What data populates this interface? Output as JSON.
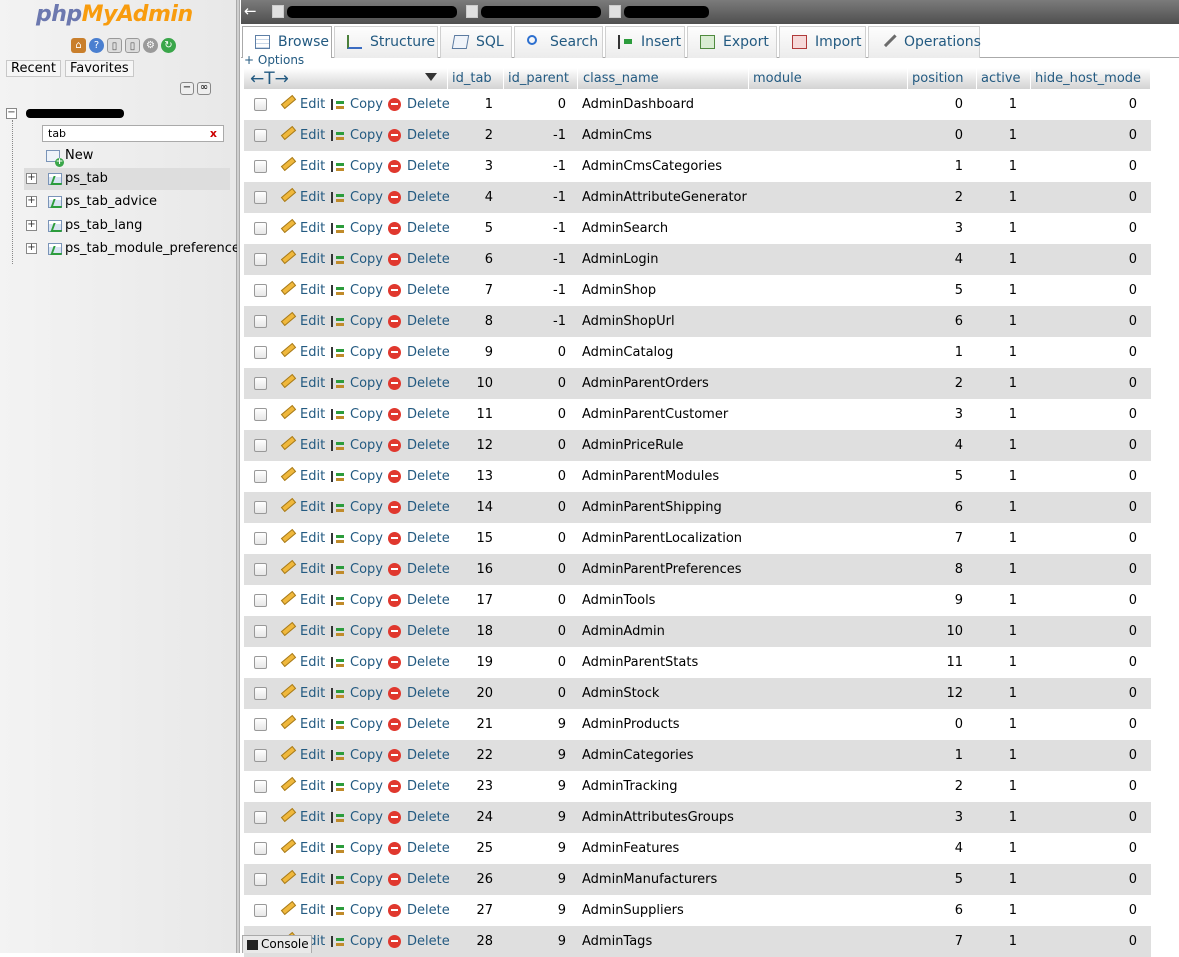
{
  "logo": {
    "php": "php",
    "myadmin": "MyAdmin"
  },
  "nav": {
    "tabs": [
      "Recent",
      "Favorites"
    ],
    "filter_value": "tab",
    "filter_clear": "x",
    "new_label": "New",
    "tables": [
      "ps_tab",
      "ps_tab_advice",
      "ps_tab_lang",
      "ps_tab_module_preference"
    ],
    "selected_table": "ps_tab"
  },
  "tabs": [
    {
      "label": "Browse",
      "icon": "browse-icon",
      "active": true
    },
    {
      "label": "Structure",
      "icon": "structure-icon"
    },
    {
      "label": "SQL",
      "icon": "sql-icon"
    },
    {
      "label": "Search",
      "icon": "search-icon"
    },
    {
      "label": "Insert",
      "icon": "insert-icon"
    },
    {
      "label": "Export",
      "icon": "export-icon"
    },
    {
      "label": "Import",
      "icon": "import-icon"
    },
    {
      "label": "Operations",
      "icon": "operations-icon"
    }
  ],
  "options_label": "+ Options",
  "column_arrows": "←T→",
  "columns": [
    "id_tab",
    "id_parent",
    "class_name",
    "module",
    "position",
    "active",
    "hide_host_mode"
  ],
  "actions": {
    "edit": "Edit",
    "copy": "Copy",
    "delete": "Delete"
  },
  "rows": [
    [
      "1",
      "0",
      "AdminDashboard",
      "",
      "0",
      "1",
      "0"
    ],
    [
      "2",
      "-1",
      "AdminCms",
      "",
      "0",
      "1",
      "0"
    ],
    [
      "3",
      "-1",
      "AdminCmsCategories",
      "",
      "1",
      "1",
      "0"
    ],
    [
      "4",
      "-1",
      "AdminAttributeGenerator",
      "",
      "2",
      "1",
      "0"
    ],
    [
      "5",
      "-1",
      "AdminSearch",
      "",
      "3",
      "1",
      "0"
    ],
    [
      "6",
      "-1",
      "AdminLogin",
      "",
      "4",
      "1",
      "0"
    ],
    [
      "7",
      "-1",
      "AdminShop",
      "",
      "5",
      "1",
      "0"
    ],
    [
      "8",
      "-1",
      "AdminShopUrl",
      "",
      "6",
      "1",
      "0"
    ],
    [
      "9",
      "0",
      "AdminCatalog",
      "",
      "1",
      "1",
      "0"
    ],
    [
      "10",
      "0",
      "AdminParentOrders",
      "",
      "2",
      "1",
      "0"
    ],
    [
      "11",
      "0",
      "AdminParentCustomer",
      "",
      "3",
      "1",
      "0"
    ],
    [
      "12",
      "0",
      "AdminPriceRule",
      "",
      "4",
      "1",
      "0"
    ],
    [
      "13",
      "0",
      "AdminParentModules",
      "",
      "5",
      "1",
      "0"
    ],
    [
      "14",
      "0",
      "AdminParentShipping",
      "",
      "6",
      "1",
      "0"
    ],
    [
      "15",
      "0",
      "AdminParentLocalization",
      "",
      "7",
      "1",
      "0"
    ],
    [
      "16",
      "0",
      "AdminParentPreferences",
      "",
      "8",
      "1",
      "0"
    ],
    [
      "17",
      "0",
      "AdminTools",
      "",
      "9",
      "1",
      "0"
    ],
    [
      "18",
      "0",
      "AdminAdmin",
      "",
      "10",
      "1",
      "0"
    ],
    [
      "19",
      "0",
      "AdminParentStats",
      "",
      "11",
      "1",
      "0"
    ],
    [
      "20",
      "0",
      "AdminStock",
      "",
      "12",
      "1",
      "0"
    ],
    [
      "21",
      "9",
      "AdminProducts",
      "",
      "0",
      "1",
      "0"
    ],
    [
      "22",
      "9",
      "AdminCategories",
      "",
      "1",
      "1",
      "0"
    ],
    [
      "23",
      "9",
      "AdminTracking",
      "",
      "2",
      "1",
      "0"
    ],
    [
      "24",
      "9",
      "AdminAttributesGroups",
      "",
      "3",
      "1",
      "0"
    ],
    [
      "25",
      "9",
      "AdminFeatures",
      "",
      "4",
      "1",
      "0"
    ],
    [
      "26",
      "9",
      "AdminManufacturers",
      "",
      "5",
      "1",
      "0"
    ],
    [
      "27",
      "9",
      "AdminSuppliers",
      "",
      "6",
      "1",
      "0"
    ],
    [
      "28",
      "9",
      "AdminTags",
      "",
      "7",
      "1",
      "0"
    ]
  ],
  "console_label": "Console"
}
